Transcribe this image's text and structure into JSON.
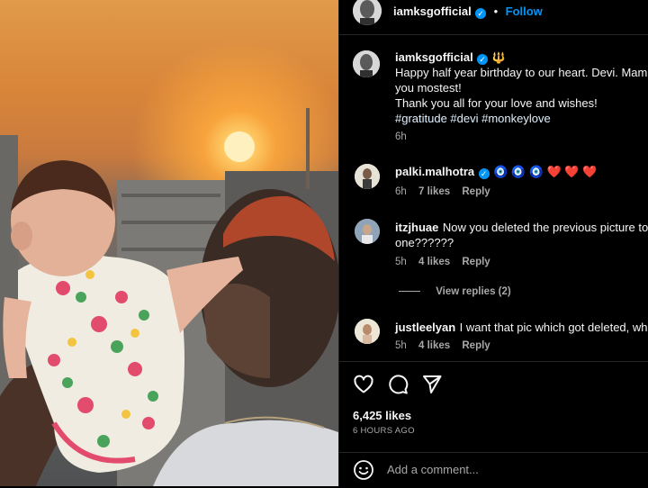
{
  "post": {
    "username": "iamksgofficial",
    "follow_label": "Follow",
    "dot": "•",
    "caption_emoji": "🔱",
    "caption_line1": "Happy half year birthday to our heart. Devi. Mam",
    "caption_line2": "you mostest!",
    "caption_line3": "Thank you all for your love and wishes!",
    "hashtags": "#gratitude #devi #monkeylove",
    "caption_time": "6h"
  },
  "comments": [
    {
      "user": "palki.malhotra",
      "text": "🧿 🧿 🧿 ❤️ ❤️ ❤️",
      "time": "6h",
      "likes": "7 likes",
      "reply": "Reply"
    },
    {
      "user": "itzjhuae",
      "text_line1": "Now you deleted the previous picture to",
      "text_line2": "one??????",
      "time": "5h",
      "likes": "4 likes",
      "reply": "Reply",
      "view_replies": "View replies (2)"
    },
    {
      "user": "justleelyan",
      "text": "I want that pic which got deleted, wha",
      "time": "5h",
      "likes": "4 likes",
      "reply": "Reply"
    }
  ],
  "footer": {
    "likes": "6,425 likes",
    "time_ago": "6 HOURS AGO",
    "comment_placeholder": "Add a comment..."
  },
  "icons": {
    "verified": "verified-badge-icon",
    "like": "heart-icon",
    "comment": "speech-bubble-icon",
    "share": "paper-plane-icon",
    "emoji": "smiley-icon"
  },
  "colors": {
    "accent": "#0095f6",
    "background": "#000000",
    "muted": "#a8a8a8"
  }
}
